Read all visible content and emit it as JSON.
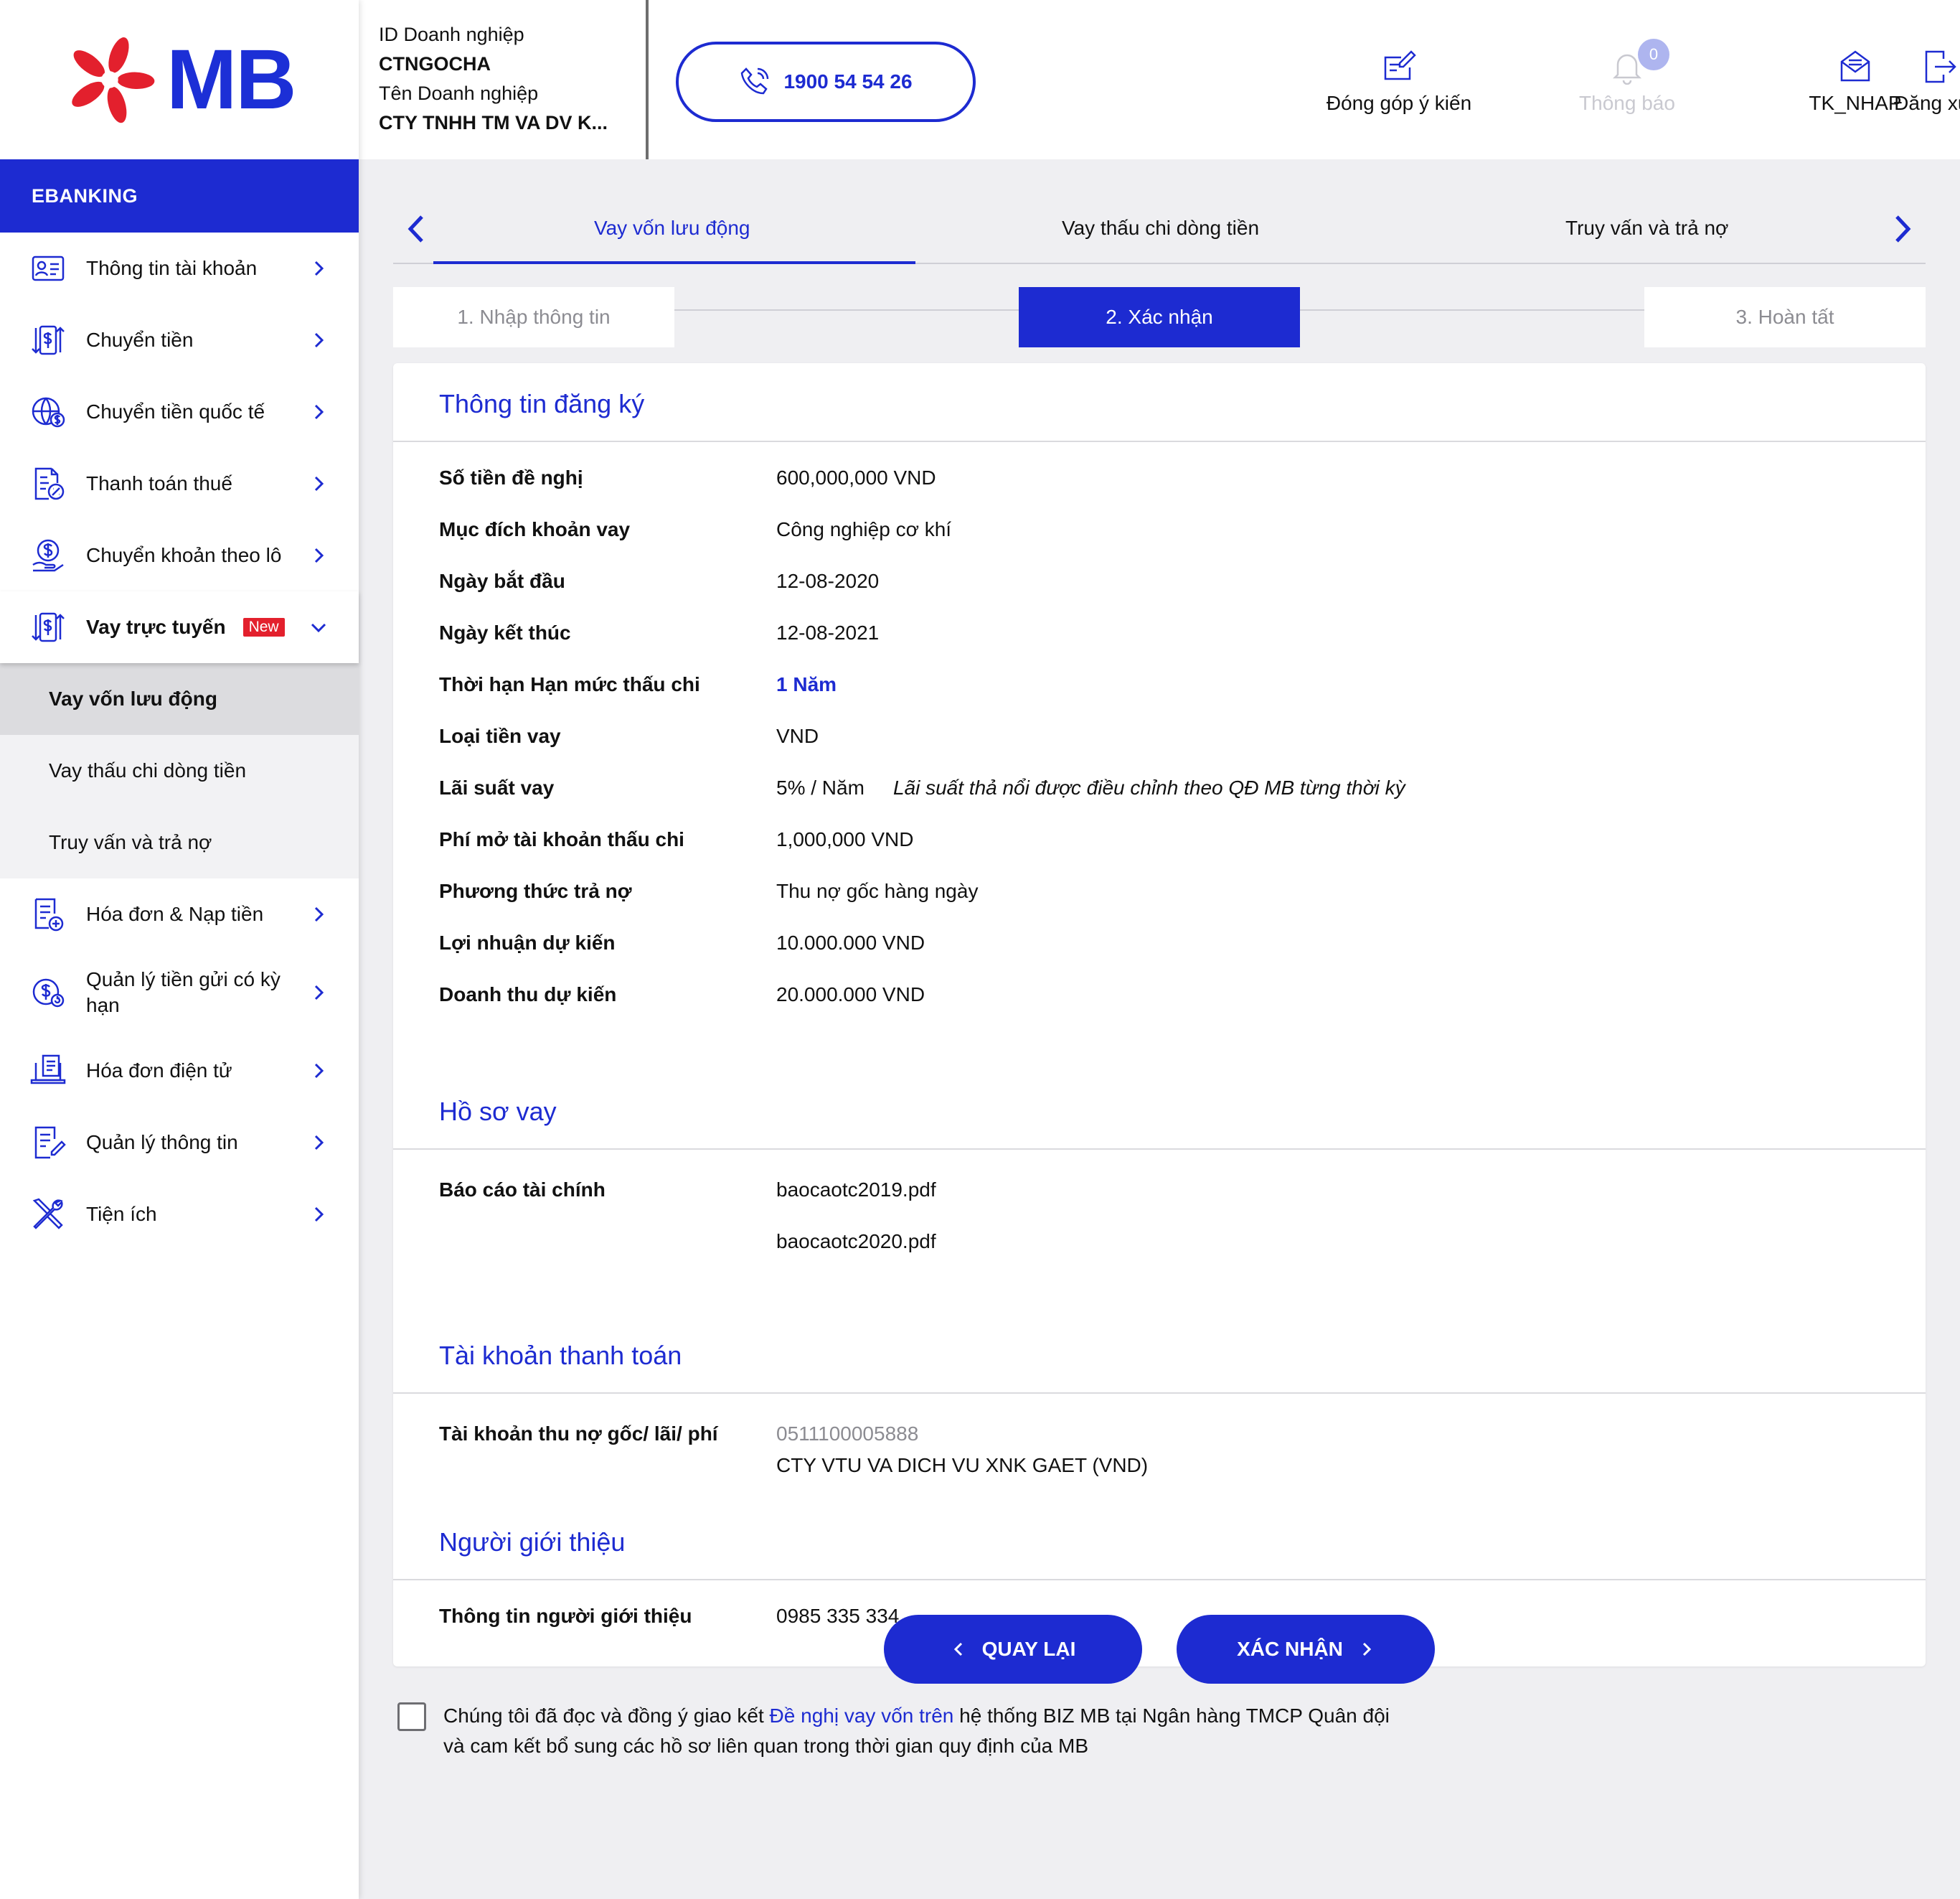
{
  "brand": {
    "logo_text": "MB",
    "primary": "#1d2bd1",
    "accent_red": "#e3202d"
  },
  "header": {
    "id_label": "ID Doanh nghiệp",
    "id_value": "CTNGOCHA",
    "name_label": "Tên Doanh nghiệp",
    "name_value": "CTY TNHH TM VA DV K...",
    "hotline": "1900 54 54 26",
    "feedback": "Đóng góp ý kiến",
    "notifications": "Thông báo",
    "notifications_count": "0",
    "user": "TK_NHAP",
    "logout": "Đăng xuất"
  },
  "sidebar": {
    "section": "EBANKING",
    "items": [
      {
        "label": "Thông tin tài khoản",
        "icon": "account-card-icon"
      },
      {
        "label": "Chuyển tiền",
        "icon": "transfer-icon"
      },
      {
        "label": "Chuyển tiền quốc tế",
        "icon": "globe-money-icon"
      },
      {
        "label": "Thanh toán thuế",
        "icon": "tax-document-icon"
      },
      {
        "label": "Chuyển khoản theo lô",
        "icon": "hand-coin-icon"
      },
      {
        "label": "Vay trực tuyến",
        "icon": "loan-icon",
        "badge": "New"
      },
      {
        "label": "Hóa đơn & Nạp tiền",
        "icon": "invoice-add-icon"
      },
      {
        "label": "Quản lý tiền gửi có kỳ hạn",
        "icon": "deposit-icon"
      },
      {
        "label": "Hóa đơn điện tử",
        "icon": "laptop-invoice-icon"
      },
      {
        "label": "Quản lý thông tin",
        "icon": "edit-document-icon"
      },
      {
        "label": "Tiện ích",
        "icon": "tools-icon"
      }
    ],
    "sub_items": [
      "Vay vốn lưu động",
      "Vay thấu chi dòng tiền",
      "Truy vấn và trả nợ"
    ]
  },
  "tabs": [
    "Vay vốn lưu động",
    "Vay thấu chi dòng tiền",
    "Truy vấn và trả nợ"
  ],
  "steps": [
    "1. Nhập thông tin",
    "2. Xác nhận",
    "3. Hoàn tất"
  ],
  "registration": {
    "title": "Thông tin đăng ký",
    "rows": [
      {
        "k": "Số tiền đề nghị",
        "v": "600,000,000 VND"
      },
      {
        "k": "Mục đích  khoản vay",
        "v": "Công nghiệp cơ khí"
      },
      {
        "k": "Ngày bắt đầu",
        "v": "12-08-2020"
      },
      {
        "k": "Ngày kết thúc",
        "v": "12-08-2021"
      },
      {
        "k": "Thời hạn Hạn mức thấu chi",
        "v": "1 Năm"
      },
      {
        "k": "Loại tiền vay",
        "v": "VND"
      },
      {
        "k": "Lãi suất vay",
        "v": "5% / Năm",
        "note": "Lãi suất thả nổi được điều chỉnh theo QĐ MB từng thời kỳ"
      },
      {
        "k": "Phí mở tài khoản thấu chi",
        "v": "1,000,000 VND"
      },
      {
        "k": "Phương thức trả nợ",
        "v": "Thu nợ gốc hàng ngày"
      },
      {
        "k": "Lợi nhuận dự kiến",
        "v": "10.000.000 VND"
      },
      {
        "k": "Doanh thu dự kiến",
        "v": "20.000.000 VND"
      }
    ]
  },
  "documents": {
    "title": "Hồ sơ vay",
    "label": "Báo cáo tài chính",
    "files": [
      "baocaotc2019.pdf",
      "baocaotc2020.pdf"
    ]
  },
  "payment_account": {
    "title": "Tài khoản thanh toán",
    "label": "Tài khoản thu nợ gốc/ lãi/ phí",
    "number": "0511100005888",
    "name": "CTY VTU VA DICH VU XNK GAET (VND)"
  },
  "referrer": {
    "title": "Người giới thiệu",
    "label": "Thông tin người giới thiệu",
    "value": "0985 335 334"
  },
  "agreement": {
    "before": "Chúng tôi đã đọc và đồng ý giao kết ",
    "link": "Đề nghị vay vốn trên",
    "after_line1": " hệ thống BIZ MB tại Ngân hàng TMCP Quân đội",
    "line2": "và cam kết bổ sung các hồ sơ liên quan trong thời gian quy định của MB"
  },
  "buttons": {
    "back": "QUAY LẠI",
    "confirm": "XÁC NHẬN"
  }
}
